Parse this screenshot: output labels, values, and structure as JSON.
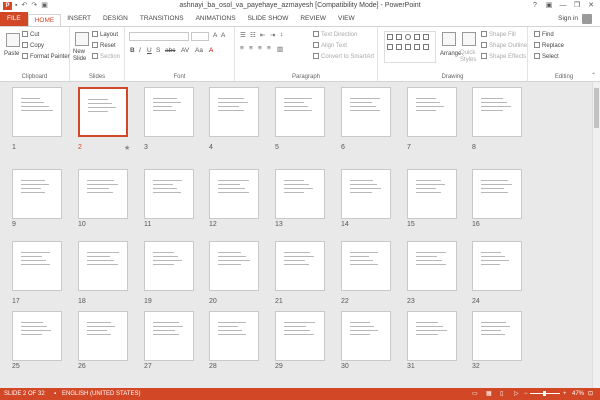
{
  "titlebar": {
    "app_icon": "P",
    "title": "ashnayi_ba_osol_va_payehaye_azmayesh [Compatibility Mode] - PowerPoint",
    "minimize": "—",
    "restore": "❐",
    "close": "✕",
    "help": "?"
  },
  "tabs": [
    "FILE",
    "HOME",
    "INSERT",
    "DESIGN",
    "TRANSITIONS",
    "ANIMATIONS",
    "SLIDE SHOW",
    "REVIEW",
    "VIEW"
  ],
  "signin": "Sign in",
  "ribbon": {
    "clipboard": {
      "label": "Clipboard",
      "paste": "Paste",
      "cut": "Cut",
      "copy": "Copy",
      "format_painter": "Format Painter"
    },
    "slides": {
      "label": "Slides",
      "new_slide": "New Slide",
      "layout": "Layout",
      "reset": "Reset",
      "section": "Section"
    },
    "font": {
      "label": "Font"
    },
    "paragraph": {
      "label": "Paragraph",
      "text_direction": "Text Direction",
      "align_text": "Align Text",
      "convert": "Convert to SmartArt"
    },
    "drawing": {
      "label": "Drawing",
      "arrange": "Arrange",
      "quick_styles": "Quick Styles",
      "shape_fill": "Shape Fill",
      "shape_outline": "Shape Outline",
      "shape_effects": "Shape Effects"
    },
    "editing": {
      "label": "Editing",
      "find": "Find",
      "replace": "Replace",
      "select": "Select"
    }
  },
  "slides": [
    {
      "n": "1"
    },
    {
      "n": "2"
    },
    {
      "n": "3"
    },
    {
      "n": "4"
    },
    {
      "n": "5"
    },
    {
      "n": "6"
    },
    {
      "n": "7"
    },
    {
      "n": "8"
    },
    {
      "n": "9"
    },
    {
      "n": "10"
    },
    {
      "n": "11"
    },
    {
      "n": "12"
    },
    {
      "n": "13"
    },
    {
      "n": "14"
    },
    {
      "n": "15"
    },
    {
      "n": "16"
    },
    {
      "n": "17"
    },
    {
      "n": "18"
    },
    {
      "n": "19"
    },
    {
      "n": "20"
    },
    {
      "n": "21"
    },
    {
      "n": "22"
    },
    {
      "n": "23"
    },
    {
      "n": "24"
    },
    {
      "n": "25"
    },
    {
      "n": "26"
    },
    {
      "n": "27"
    },
    {
      "n": "28"
    },
    {
      "n": "29"
    },
    {
      "n": "30"
    },
    {
      "n": "31"
    },
    {
      "n": "32"
    }
  ],
  "selected_slide": "2",
  "transition_mark": "★",
  "status": {
    "slide_info": "SLIDE 2 OF 32",
    "language": "ENGLISH (UNITED STATES)",
    "zoom": "47%"
  },
  "colors": {
    "accent": "#d24726"
  }
}
